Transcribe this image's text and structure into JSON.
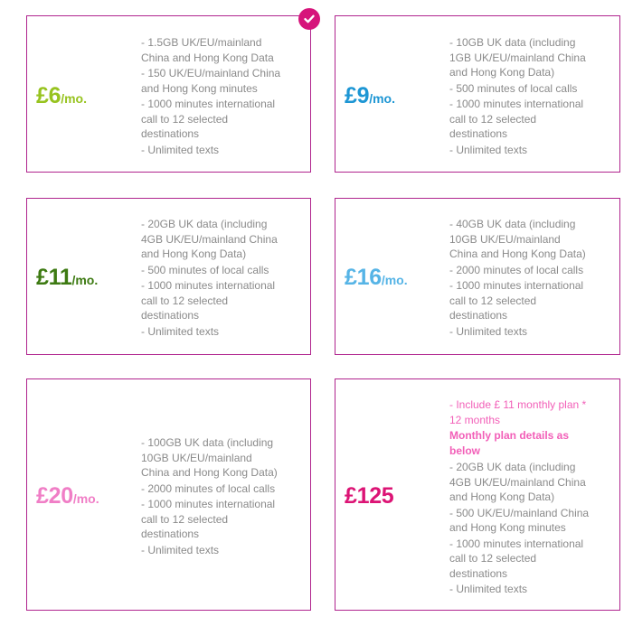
{
  "plans": [
    {
      "price": "£6",
      "suffix": "/mo.",
      "color": "#97c31f",
      "selected": true,
      "features": [
        "- 1.5GB UK/EU/mainland China and Hong Kong Data",
        "- 150 UK/EU/mainland China and Hong Kong minutes",
        "- 1000 minutes international call to 12 selected destinations",
        "- Unlimited texts"
      ]
    },
    {
      "price": "£9",
      "suffix": "/mo.",
      "color": "#1d96d4",
      "selected": false,
      "features": [
        "- 10GB UK data (including 1GB UK/EU/mainland China and Hong Kong Data)",
        "- 500 minutes of local calls",
        "- 1000 minutes international call to 12 selected destinations",
        "- Unlimited texts"
      ]
    },
    {
      "price": "£11",
      "suffix": "/mo.",
      "color": "#3d7a12",
      "selected": false,
      "features": [
        "- 20GB UK data (including 4GB UK/EU/mainland China and Hong Kong Data)",
        "- 500 minutes of local calls",
        "- 1000 minutes international call to 12 selected destinations",
        "- Unlimited texts"
      ]
    },
    {
      "price": "£16",
      "suffix": "/mo.",
      "color": "#56b4e6",
      "selected": false,
      "features": [
        "- 40GB UK data (including 10GB UK/EU/mainland China and Hong Kong Data)",
        "- 2000 minutes of local calls",
        "- 1000 minutes international call to 12 selected destinations",
        "- Unlimited texts"
      ]
    },
    {
      "price": "£20",
      "suffix": "/mo.",
      "color": "#f07ec6",
      "selected": false,
      "features": [
        "- 100GB UK data (including 10GB UK/EU/mainland China and Hong Kong Data)",
        "- 2000 minutes of local calls",
        "- 1000 minutes international call to 12 selected destinations",
        "- Unlimited texts"
      ]
    },
    {
      "price": "£125",
      "suffix": "",
      "color": "#dc1475",
      "selected": false,
      "intro": "- Include  £ 11 monthly plan * 12 months",
      "intro_bold": "Monthly plan details as below",
      "features": [
        "- 20GB UK data (including 4GB UK/EU/mainland China and Hong Kong Data)",
        "- 500 UK/EU/mainland China and Hong Kong minutes",
        "- 1000 minutes international call to 12 selected destinations",
        "- Unlimited texts"
      ]
    }
  ],
  "colors": {
    "border": "#b0248e",
    "check_badge": "#d6147b",
    "feature_text": "#8a8a8a",
    "intro_text": "#f25fb8"
  },
  "icons": {
    "selected": "check-icon"
  }
}
